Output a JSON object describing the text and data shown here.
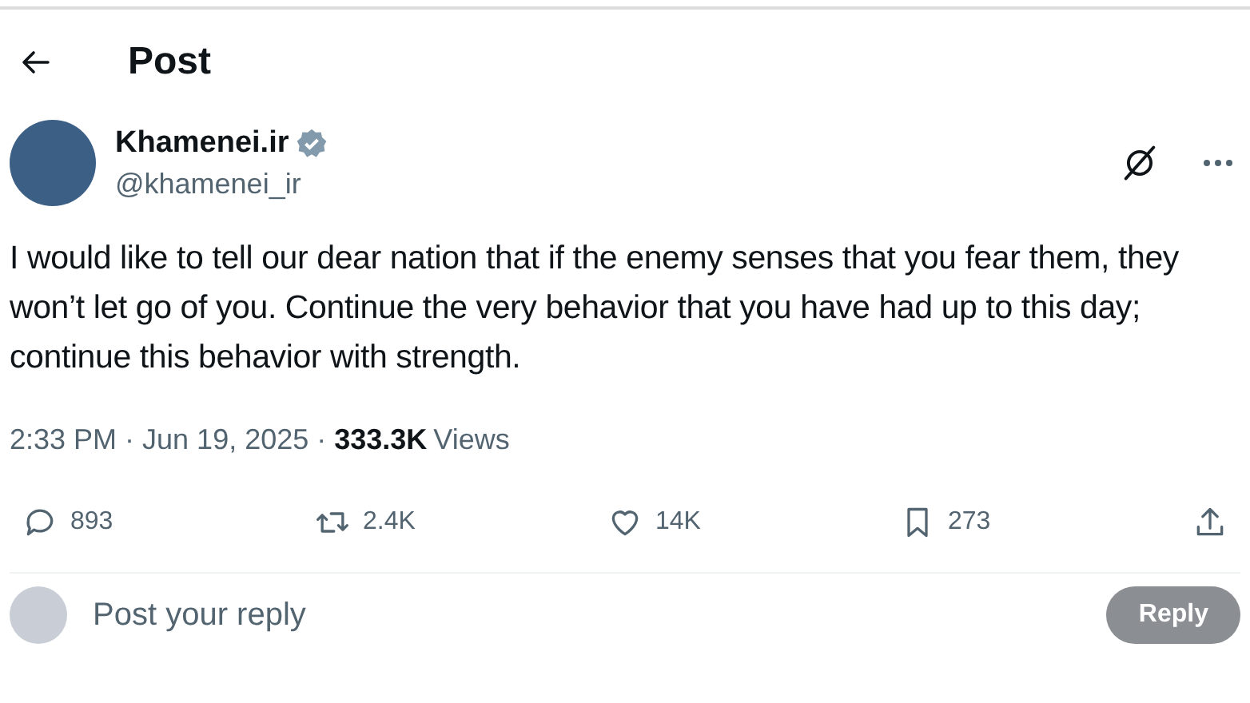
{
  "header": {
    "title": "Post"
  },
  "author": {
    "name": "Khamenei.ir",
    "handle": "@khamenei_ir",
    "verified": true
  },
  "post": {
    "text": "I would like to tell our dear nation that if the enemy senses that you fear them, they won’t let go of you. Continue the very behavior that you have had up to this day; continue this behavior with strength.",
    "time": "2:33 PM · Jun 19, 2025 · ",
    "views_count": "333.3K",
    "views_label": "Views"
  },
  "actions": [
    {
      "kind": "reply",
      "count": "893"
    },
    {
      "kind": "repost",
      "count": "2.4K"
    },
    {
      "kind": "like",
      "count": "14K"
    },
    {
      "kind": "bookmark",
      "count": "273"
    },
    {
      "kind": "share"
    }
  ],
  "reply_box": {
    "placeholder": "Post your reply",
    "button": "Reply",
    "disabled": true
  }
}
